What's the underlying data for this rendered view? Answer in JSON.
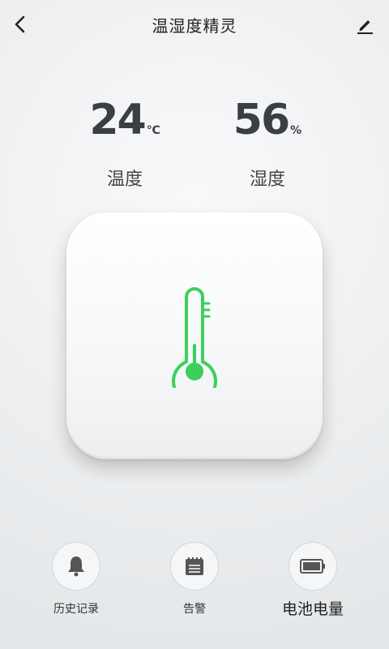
{
  "header": {
    "title": "温湿度精灵",
    "back_icon": "back-arrow-icon",
    "edit_icon": "edit-pencil-icon"
  },
  "readings": {
    "temperature": {
      "value": "24",
      "unit": "℃",
      "label": "温度"
    },
    "humidity": {
      "value": "56",
      "unit": "%",
      "label": "湿度"
    }
  },
  "device": {
    "icon": "thermometer-icon",
    "accent_color": "#3ccf5c"
  },
  "actions": [
    {
      "label": "历史记录",
      "icon": "bell-icon"
    },
    {
      "label": "告警",
      "icon": "calendar-icon"
    },
    {
      "label": "电池电量",
      "icon": "battery-icon"
    }
  ]
}
